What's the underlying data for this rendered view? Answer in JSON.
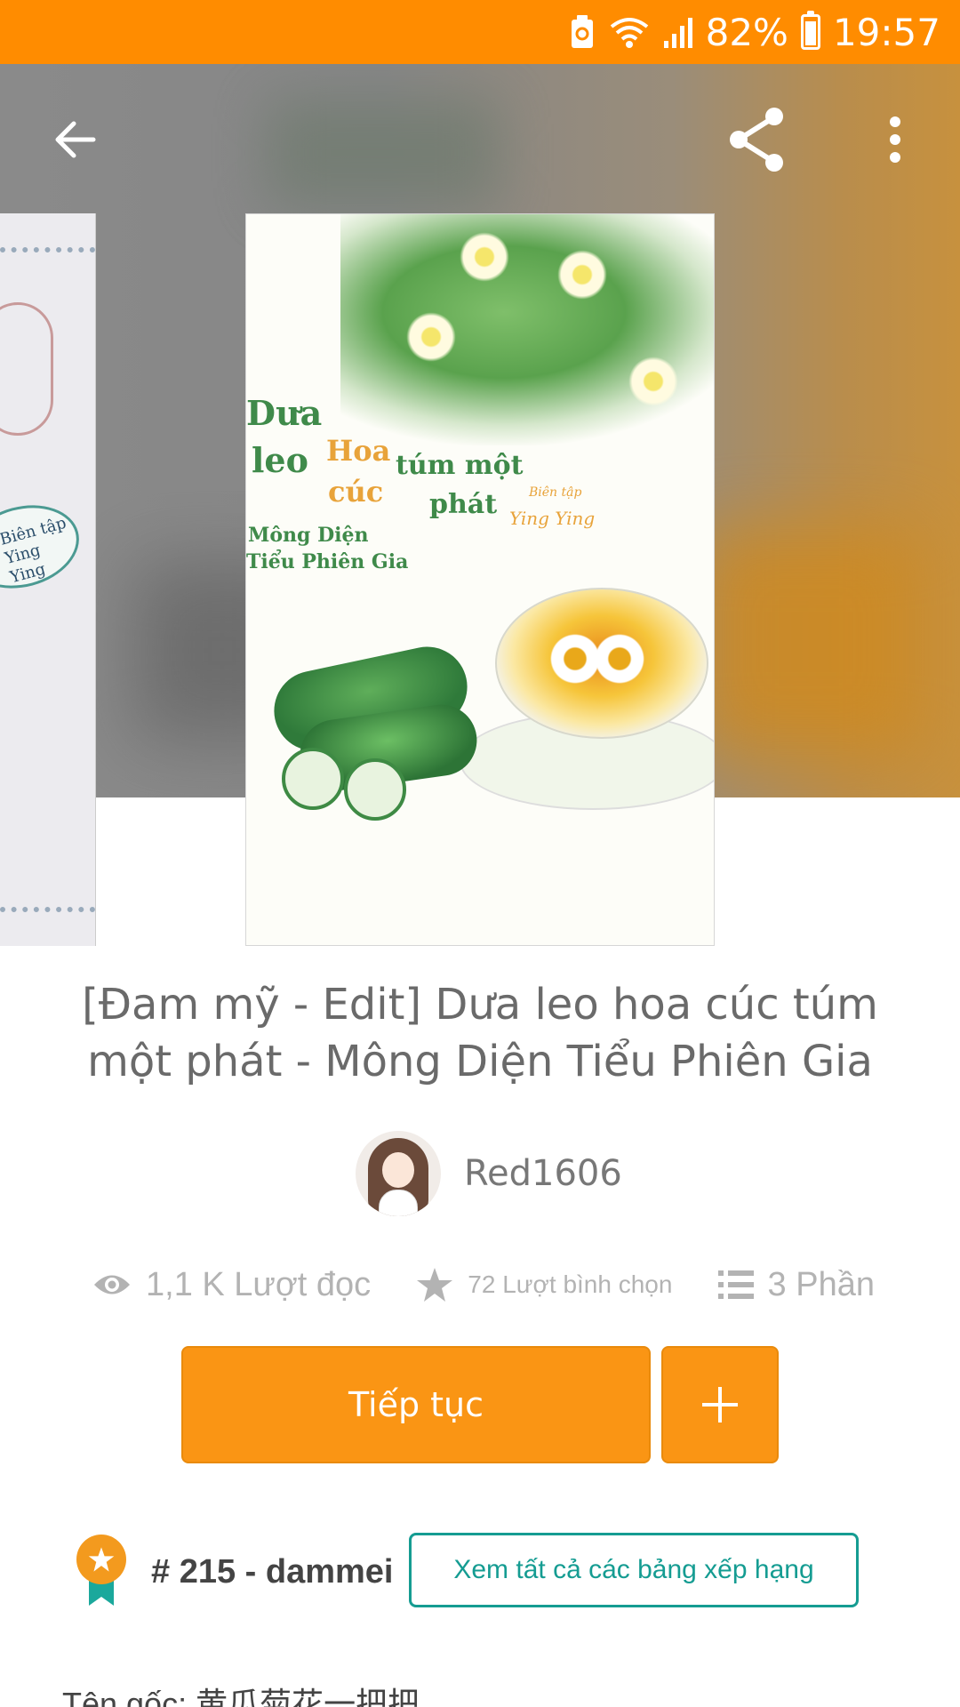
{
  "status_bar": {
    "battery_pct": "82%",
    "time": "19:57",
    "icons": [
      "battery-saver-icon",
      "wifi-icon",
      "signal-icon",
      "battery-icon"
    ]
  },
  "toolbar": {
    "back_icon": "arrow-left-icon",
    "share_icon": "share-icon",
    "more_icon": "more-vertical-icon"
  },
  "cover": {
    "lines": [
      "Dưa",
      "leo",
      "Hoa",
      "cúc",
      "túm một",
      "phát",
      "Mông Diện",
      "Tiểu Phiên Gia",
      "Biên tập",
      "Ying Ying"
    ]
  },
  "side_cover": {
    "badge_text": "Biên tập Ying Ying"
  },
  "story": {
    "title": "[Đam mỹ - Edit] Dưa leo hoa cúc túm một phát - Mông Diện Tiểu Phiên Gia",
    "author": "Red1606"
  },
  "stats": {
    "reads": "1,1 K Lượt đọc",
    "votes": "72 Lượt bình chọn",
    "parts": "3 Phần"
  },
  "actions": {
    "continue_label": "Tiếp tục",
    "add_label": "+"
  },
  "ranking": {
    "text": "# 215 - dammei",
    "view_all_label": "Xem tất cả các bảng xếp hạng"
  },
  "details": {
    "original_name": "Tên gốc: 黄瓜菊花一把把"
  },
  "colors": {
    "status_bar": "#ff8c00",
    "accent": "#fa9514",
    "teal": "#159c92"
  }
}
